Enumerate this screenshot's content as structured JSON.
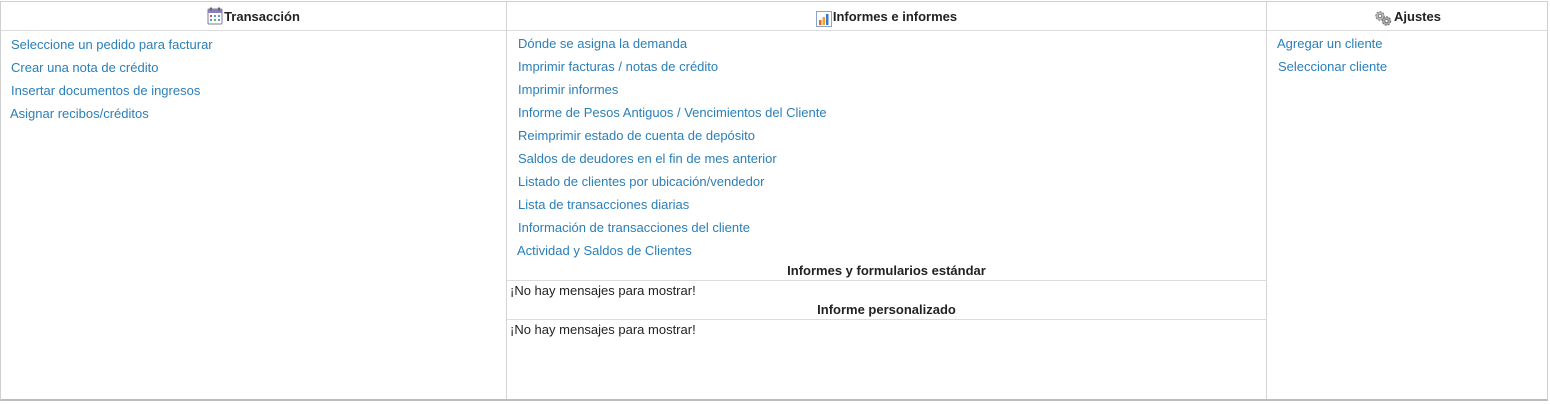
{
  "transaction": {
    "title": "Transacción",
    "icon": "calendar-icon",
    "links": [
      {
        "label": "Seleccione un pedido para facturar"
      },
      {
        "label": "Crear una nota de crédito"
      },
      {
        "label": "Insertar documentos de ingresos"
      },
      {
        "label": "Asignar recibos/créditos"
      }
    ]
  },
  "reports": {
    "title": "Informes e informes",
    "icon": "bar-chart-icon",
    "links": [
      {
        "label": "Dónde se asigna la demanda"
      },
      {
        "label": "Imprimir facturas / notas de crédito"
      },
      {
        "label": "Imprimir informes"
      },
      {
        "label": "Informe de Pesos Antiguos / Vencimientos del Cliente"
      },
      {
        "label": "Reimprimir estado de cuenta de depósito"
      },
      {
        "label": "Saldos de deudores en el fin de mes anterior"
      },
      {
        "label": "Listado de clientes por ubicación/vendedor"
      },
      {
        "label": "Lista de transacciones diarias"
      },
      {
        "label": "Información de transacciones del cliente"
      },
      {
        "label": "Actividad y Saldos de Clientes"
      }
    ],
    "standard_title": "Informes y formularios estándar",
    "standard_empty": "¡No hay mensajes para mostrar!",
    "custom_title": "Informe personalizado",
    "custom_empty": "¡No hay mensajes para mostrar!"
  },
  "settings": {
    "title": "Ajustes",
    "icon": "gears-icon",
    "links": [
      {
        "label": "Agregar un cliente"
      },
      {
        "label": "Seleccionar cliente"
      }
    ]
  },
  "colors": {
    "link": "#2a7fb8",
    "border": "#d4d4d4",
    "text": "#222222"
  }
}
